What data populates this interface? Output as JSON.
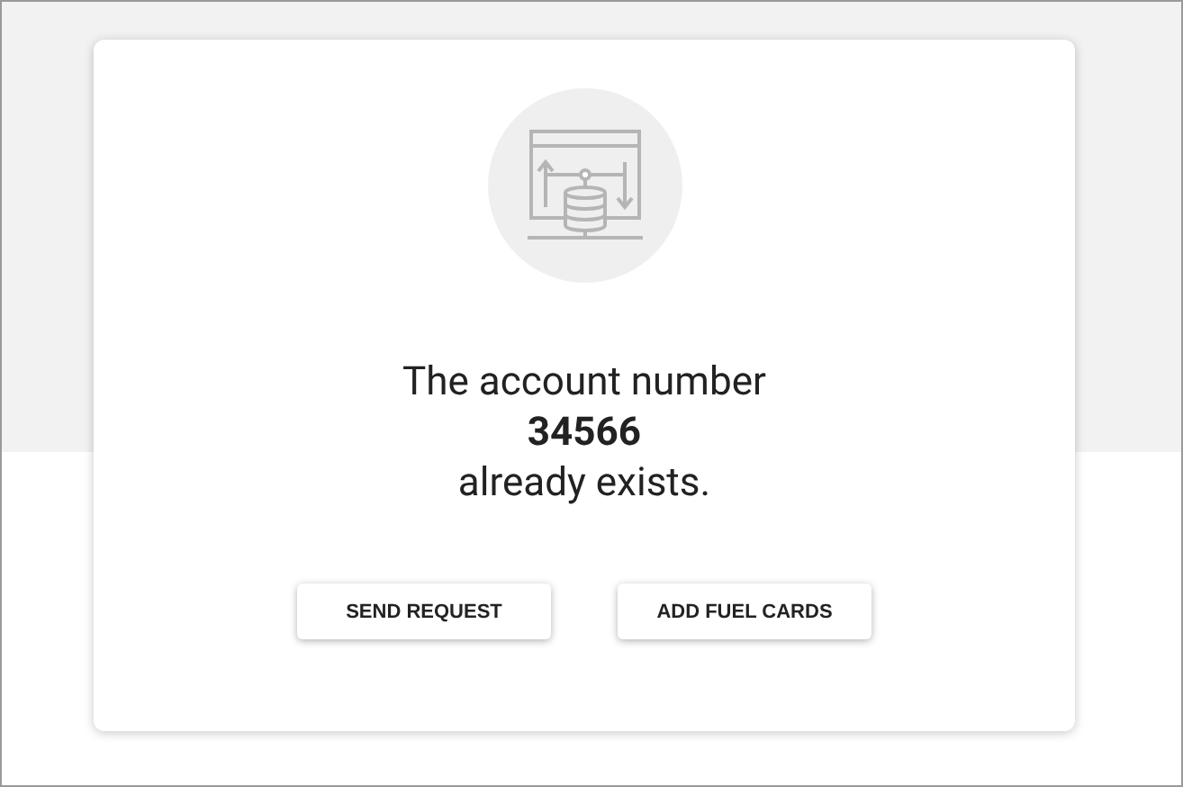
{
  "dialog": {
    "message_before": "The account number",
    "account_number": "34566",
    "message_after": "already exists.",
    "buttons": [
      {
        "label": "SEND REQUEST"
      },
      {
        "label": "ADD FUEL CARDS"
      }
    ]
  }
}
